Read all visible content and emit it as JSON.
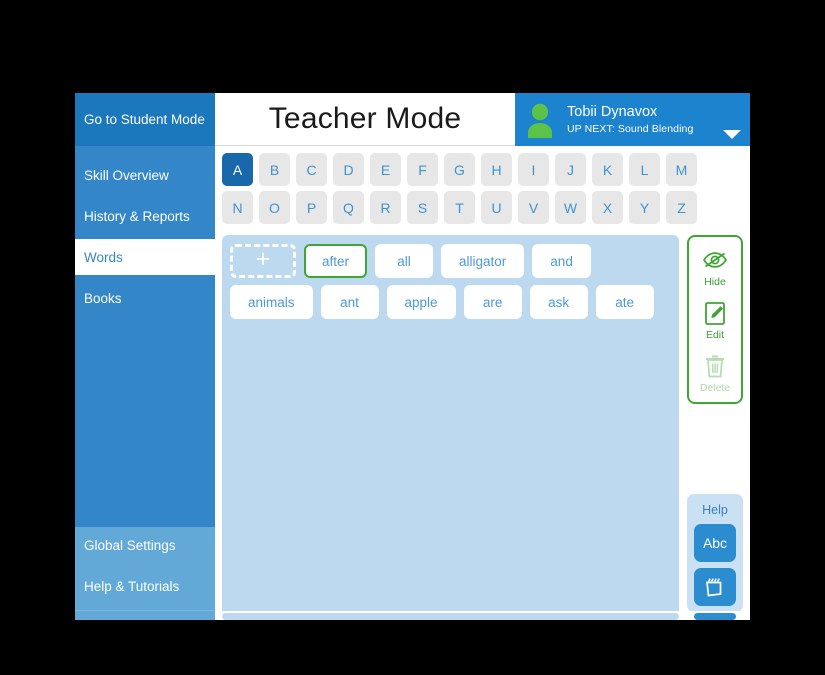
{
  "header": {
    "student_mode_label": "Go to Student Mode",
    "title": "Teacher Mode",
    "profile_name": "Tobii Dynavox",
    "profile_subtitle": "UP NEXT: Sound Blending",
    "avatar_icon": "person-icon",
    "chevron_icon": "chevron-down-icon"
  },
  "sidebar": {
    "items": [
      {
        "label": "Skill Overview",
        "active": false
      },
      {
        "label": "History & Reports",
        "active": false
      },
      {
        "label": "Words",
        "active": true
      },
      {
        "label": "Books",
        "active": false
      }
    ],
    "bottom_items": [
      {
        "label": "Global Settings"
      },
      {
        "label": "Help & Tutorials"
      }
    ]
  },
  "alphabet": {
    "row1": [
      "A",
      "B",
      "C",
      "D",
      "E",
      "F",
      "G",
      "H",
      "I",
      "J",
      "K",
      "L",
      "M"
    ],
    "row2": [
      "N",
      "O",
      "P",
      "Q",
      "R",
      "S",
      "T",
      "U",
      "V",
      "W",
      "X",
      "Y",
      "Z"
    ],
    "selected": "A"
  },
  "words": {
    "add_label": "+",
    "items": [
      {
        "label": "after",
        "selected": true
      },
      {
        "label": "all",
        "selected": false
      },
      {
        "label": "alligator",
        "selected": false
      },
      {
        "label": "and",
        "selected": false
      },
      {
        "label": "animals",
        "selected": false
      },
      {
        "label": "ant",
        "selected": false
      },
      {
        "label": "apple",
        "selected": false
      },
      {
        "label": "are",
        "selected": false
      },
      {
        "label": "ask",
        "selected": false
      },
      {
        "label": "ate",
        "selected": false
      }
    ]
  },
  "actions": [
    {
      "label": "Hide",
      "icon": "eye-slash-icon",
      "disabled": false
    },
    {
      "label": "Edit",
      "icon": "pencil-note-icon",
      "disabled": false
    },
    {
      "label": "Delete",
      "icon": "trash-icon",
      "disabled": true
    }
  ],
  "help": {
    "label": "Help",
    "abc_label": "Abc",
    "book_icon": "flipbook-icon"
  },
  "colors": {
    "header_blue": "#1c78bd",
    "profile_blue": "#1c83cf",
    "sidebar_blue": "#3387c9",
    "sidebar_bottom_blue": "#62a9d8",
    "words_panel_blue": "#bdd9ef",
    "selected_letter_blue": "#1868ab",
    "accent_green": "#3fa535",
    "button_blue": "#2b8dd0",
    "letter_tile_grey": "#e7e7e7"
  }
}
